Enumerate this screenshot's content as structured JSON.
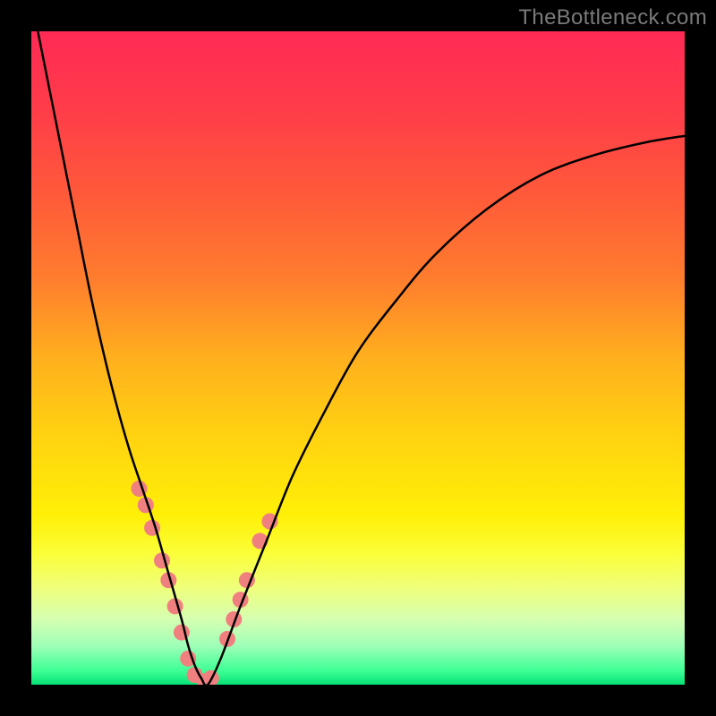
{
  "watermark": "TheBottleneck.com",
  "chart_data": {
    "type": "line",
    "title": "",
    "xlabel": "",
    "ylabel": "",
    "xlim": [
      0,
      100
    ],
    "ylim": [
      0,
      100
    ],
    "grid": false,
    "legend": false,
    "background_gradient": {
      "stops": [
        {
          "pos": 0.0,
          "color": "#ff2a55"
        },
        {
          "pos": 0.12,
          "color": "#ff3d4a"
        },
        {
          "pos": 0.25,
          "color": "#ff5a3a"
        },
        {
          "pos": 0.38,
          "color": "#ff7e2e"
        },
        {
          "pos": 0.5,
          "color": "#ffb01e"
        },
        {
          "pos": 0.62,
          "color": "#ffd311"
        },
        {
          "pos": 0.74,
          "color": "#fff007"
        },
        {
          "pos": 0.8,
          "color": "#fbff3a"
        },
        {
          "pos": 0.85,
          "color": "#f0ff7a"
        },
        {
          "pos": 0.9,
          "color": "#d6ffb2"
        },
        {
          "pos": 0.94,
          "color": "#a0ffb8"
        },
        {
          "pos": 0.98,
          "color": "#3bff94"
        },
        {
          "pos": 1.0,
          "color": "#05e276"
        }
      ]
    },
    "series": [
      {
        "name": "bottleneck-curve",
        "color": "#000000",
        "x": [
          1,
          3,
          5,
          7,
          9,
          11,
          13,
          15,
          17,
          19,
          21,
          23,
          24,
          25,
          26,
          27,
          29,
          32,
          36,
          40,
          45,
          50,
          56,
          62,
          70,
          78,
          86,
          94,
          100
        ],
        "y": [
          100,
          90,
          80,
          70,
          60,
          51,
          43,
          36,
          30,
          24,
          17,
          10,
          6,
          3,
          1,
          0,
          4,
          12,
          22,
          32,
          42,
          51,
          59,
          66,
          73,
          78,
          81,
          83,
          84
        ]
      }
    ],
    "scatter_points": {
      "name": "marker-dots",
      "color": "#f08080",
      "radius_px": 9,
      "x": [
        16.5,
        17.5,
        18.5,
        20,
        21,
        22,
        23,
        24,
        25,
        26.5,
        27.5,
        30,
        31,
        32,
        33,
        35,
        36.5
      ],
      "y": [
        30,
        27.5,
        24,
        19,
        16,
        12,
        8,
        4,
        1.5,
        0.5,
        1,
        7,
        10,
        13,
        16,
        22,
        25
      ]
    }
  }
}
